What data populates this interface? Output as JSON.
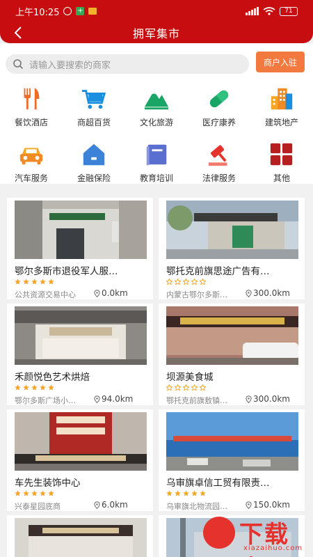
{
  "status_bar": {
    "time": "上午10:25",
    "battery": "71",
    "plus_badge": "+"
  },
  "nav": {
    "title": "拥军集市"
  },
  "search": {
    "placeholder": "请输入要搜索的商家",
    "join_label": "商户入驻"
  },
  "categories": [
    {
      "label": "餐饮酒店",
      "icon": "fork-knife-icon"
    },
    {
      "label": "商超百货",
      "icon": "shopping-cart-icon"
    },
    {
      "label": "文化旅游",
      "icon": "mountain-icon"
    },
    {
      "label": "医疗康养",
      "icon": "pill-icon"
    },
    {
      "label": "建筑地产",
      "icon": "buildings-icon"
    },
    {
      "label": "汽车服务",
      "icon": "car-icon"
    },
    {
      "label": "金融保险",
      "icon": "bank-icon"
    },
    {
      "label": "教育培训",
      "icon": "book-icon"
    },
    {
      "label": "法律服务",
      "icon": "gavel-icon"
    },
    {
      "label": "其他",
      "icon": "grid-icon"
    }
  ],
  "merchants": [
    {
      "name": "鄂尔多斯市退役军人服…",
      "address": "公共资源交易中心",
      "distance": "0.0km",
      "rating": 5
    },
    {
      "name": "鄂托克前旗思途广告有…",
      "address": "内蒙古鄂尔多斯…",
      "distance": "300.0km",
      "rating": 0
    },
    {
      "name": "禾颜悦色艺术烘焙",
      "address": "鄂尔多斯广场小…",
      "distance": "94.0km",
      "rating": 5
    },
    {
      "name": "坝源美食城",
      "address": "鄂托克前旗敖镇…",
      "distance": "300.0km",
      "rating": 0
    },
    {
      "name": "车先生装饰中心",
      "address": "兴泰星园底商",
      "distance": "6.0km",
      "rating": 5
    },
    {
      "name": "乌审旗卓信工贸有限责…",
      "address": "乌审旗北物流园…",
      "distance": "150.0km",
      "rating": 5
    },
    {
      "name": "",
      "address": "",
      "distance": "",
      "rating": 0
    },
    {
      "name": "",
      "address": "",
      "distance": "",
      "rating": 0
    }
  ],
  "watermark": {
    "text": "下载火",
    "sub": "xiazaihuo.com"
  },
  "colors": {
    "brand_red": "#c70d10",
    "join_orange": "#f27a3e",
    "star_orange": "#f5a623"
  }
}
